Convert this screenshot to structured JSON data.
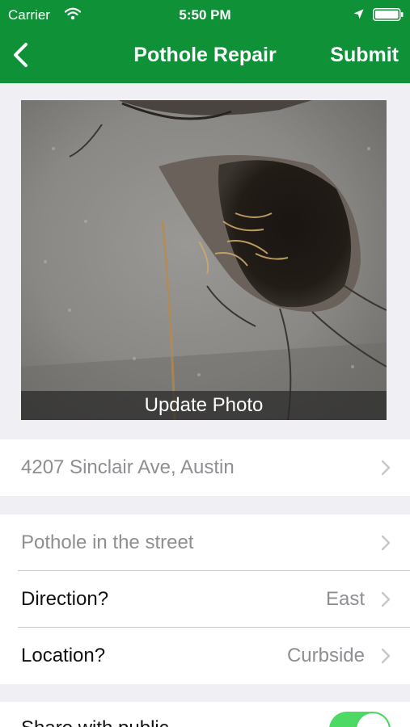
{
  "status_bar": {
    "carrier": "Carrier",
    "time": "5:50 PM"
  },
  "nav": {
    "title": "Pothole Repair",
    "submit_label": "Submit"
  },
  "photo": {
    "update_label": "Update Photo"
  },
  "address": {
    "text": "4207 Sinclair Ave, Austin"
  },
  "details": {
    "category": "Pothole in the street",
    "direction_label": "Direction?",
    "direction_value": "East",
    "location_label": "Location?",
    "location_value": "Curbside"
  },
  "share": {
    "label": "Share with public",
    "enabled": true
  },
  "colors": {
    "accent": "#0F9138",
    "toggle_on": "#4CD964",
    "muted_text": "#8E8E93"
  },
  "icons": [
    "wifi-icon",
    "location-arrow-icon",
    "battery-icon",
    "back-chevron-icon",
    "chevron-right-icon"
  ]
}
